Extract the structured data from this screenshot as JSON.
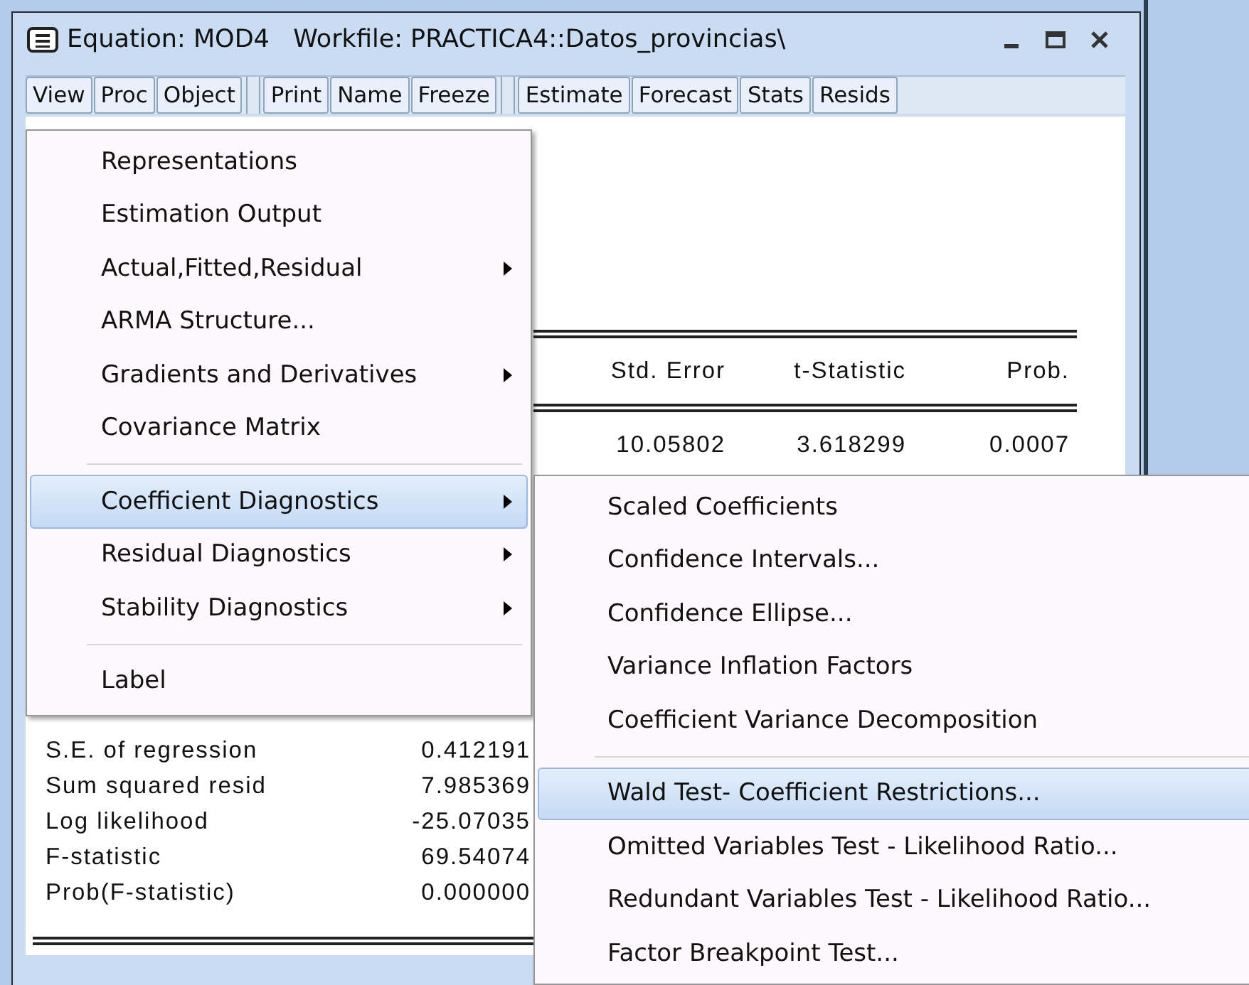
{
  "window": {
    "title": "Equation: MOD4   Workfile: PRACTICA4::Datos_provincias\\"
  },
  "toolbar": [
    [
      "View",
      "Proc",
      "Object"
    ],
    [
      "Print",
      "Name",
      "Freeze"
    ],
    [
      "Estimate",
      "Forecast",
      "Stats",
      "Resids"
    ]
  ],
  "output": {
    "header": [
      "Std. Error",
      "t-Statistic",
      "Prob."
    ],
    "row": [
      "10.05802",
      "3.618299",
      "0.0007"
    ],
    "stats": [
      {
        "label": "S.E. of regression",
        "value": "0.412191"
      },
      {
        "label": "Sum squared resid",
        "value": "7.985369"
      },
      {
        "label": "Log likelihood",
        "value": "-25.07035"
      },
      {
        "label": "F-statistic",
        "value": "69.54074"
      },
      {
        "label": "Prob(F-statistic)",
        "value": "0.000000"
      }
    ]
  },
  "view_menu": [
    {
      "kind": "item",
      "label": "Representations",
      "submenu": false,
      "selected": false
    },
    {
      "kind": "item",
      "label": "Estimation Output",
      "submenu": false,
      "selected": false
    },
    {
      "kind": "item",
      "label": "Actual,Fitted,Residual",
      "submenu": true,
      "selected": false
    },
    {
      "kind": "item",
      "label": "ARMA Structure...",
      "submenu": false,
      "selected": false
    },
    {
      "kind": "item",
      "label": "Gradients and Derivatives",
      "submenu": true,
      "selected": false
    },
    {
      "kind": "item",
      "label": "Covariance Matrix",
      "submenu": false,
      "selected": false
    },
    {
      "kind": "separator"
    },
    {
      "kind": "item",
      "label": "Coefficient Diagnostics",
      "submenu": true,
      "selected": true
    },
    {
      "kind": "item",
      "label": "Residual Diagnostics",
      "submenu": true,
      "selected": false
    },
    {
      "kind": "item",
      "label": "Stability Diagnostics",
      "submenu": true,
      "selected": false
    },
    {
      "kind": "separator"
    },
    {
      "kind": "item",
      "label": "Label",
      "submenu": false,
      "selected": false
    }
  ],
  "coefficient_submenu": [
    {
      "kind": "item",
      "label": "Scaled Coefficients",
      "selected": false
    },
    {
      "kind": "item",
      "label": "Confidence Intervals...",
      "selected": false
    },
    {
      "kind": "item",
      "label": "Confidence Ellipse...",
      "selected": false
    },
    {
      "kind": "item",
      "label": "Variance Inflation Factors",
      "selected": false
    },
    {
      "kind": "item",
      "label": "Coefficient Variance Decomposition",
      "selected": false
    },
    {
      "kind": "separator"
    },
    {
      "kind": "item",
      "label": "Wald Test- Coefficient Restrictions...",
      "selected": true
    },
    {
      "kind": "item",
      "label": "Omitted Variables Test - Likelihood Ratio...",
      "selected": false
    },
    {
      "kind": "item",
      "label": "Redundant Variables Test - Likelihood Ratio...",
      "selected": false
    },
    {
      "kind": "item",
      "label": "Factor Breakpoint Test...",
      "selected": false
    }
  ]
}
